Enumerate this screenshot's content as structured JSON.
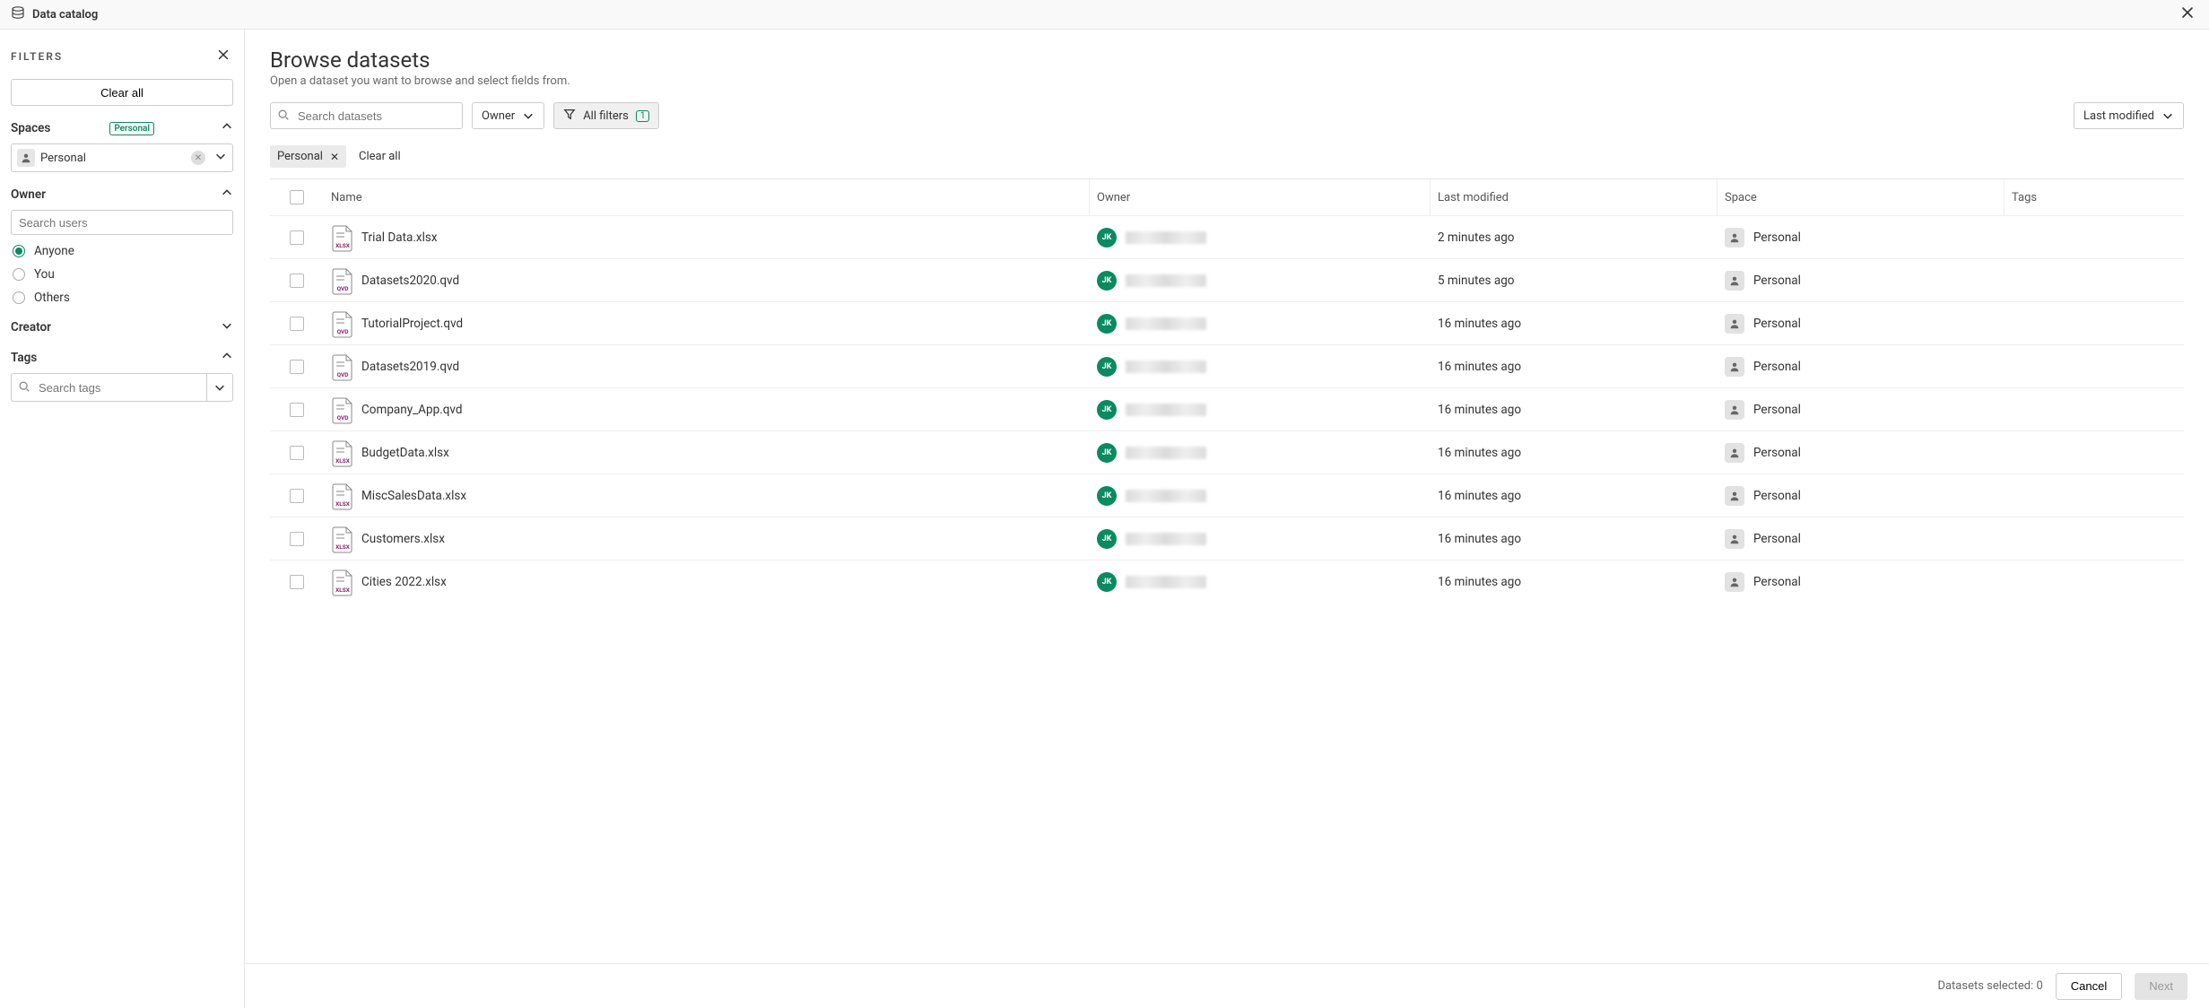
{
  "topbar": {
    "title": "Data catalog"
  },
  "sidebar": {
    "header_label": "FILTERS",
    "clear_all": "Clear all",
    "spaces": {
      "label": "Spaces",
      "badge": "Personal",
      "selected": "Personal"
    },
    "owner": {
      "label": "Owner",
      "search_placeholder": "Search users",
      "options": {
        "anyone": "Anyone",
        "you": "You",
        "others": "Others"
      },
      "selected": "anyone"
    },
    "creator": {
      "label": "Creator"
    },
    "tags": {
      "label": "Tags",
      "search_placeholder": "Search tags"
    }
  },
  "page": {
    "title": "Browse datasets",
    "subtitle": "Open a dataset you want to browse and select fields from."
  },
  "controls": {
    "search_placeholder": "Search datasets",
    "owner_dd": "Owner",
    "all_filters": "All filters",
    "all_filters_count": "1",
    "sort": "Last modified"
  },
  "chips": {
    "personal": "Personal",
    "clear_all": "Clear all"
  },
  "columns": {
    "name": "Name",
    "owner": "Owner",
    "modified": "Last modified",
    "space": "Space",
    "tags": "Tags"
  },
  "avatar_initials": "JK",
  "space_value": "Personal",
  "rows": [
    {
      "name": "Trial Data.xlsx",
      "type": "XLSX",
      "modified": "2 minutes ago"
    },
    {
      "name": "Datasets2020.qvd",
      "type": "QVD",
      "modified": "5 minutes ago"
    },
    {
      "name": "TutorialProject.qvd",
      "type": "QVD",
      "modified": "16 minutes ago"
    },
    {
      "name": "Datasets2019.qvd",
      "type": "QVD",
      "modified": "16 minutes ago"
    },
    {
      "name": "Company_App.qvd",
      "type": "QVD",
      "modified": "16 minutes ago"
    },
    {
      "name": "BudgetData.xlsx",
      "type": "XLSX",
      "modified": "16 minutes ago"
    },
    {
      "name": "MiscSalesData.xlsx",
      "type": "XLSX",
      "modified": "16 minutes ago"
    },
    {
      "name": "Customers.xlsx",
      "type": "XLSX",
      "modified": "16 minutes ago"
    },
    {
      "name": "Cities 2022.xlsx",
      "type": "XLSX",
      "modified": "16 minutes ago"
    }
  ],
  "footer": {
    "selected_label": "Datasets selected: 0",
    "cancel": "Cancel",
    "next": "Next"
  },
  "colors": {
    "accent": "#0a8a5f",
    "xlsx": "#8a1f6b",
    "qvd": "#8a1f6b"
  }
}
